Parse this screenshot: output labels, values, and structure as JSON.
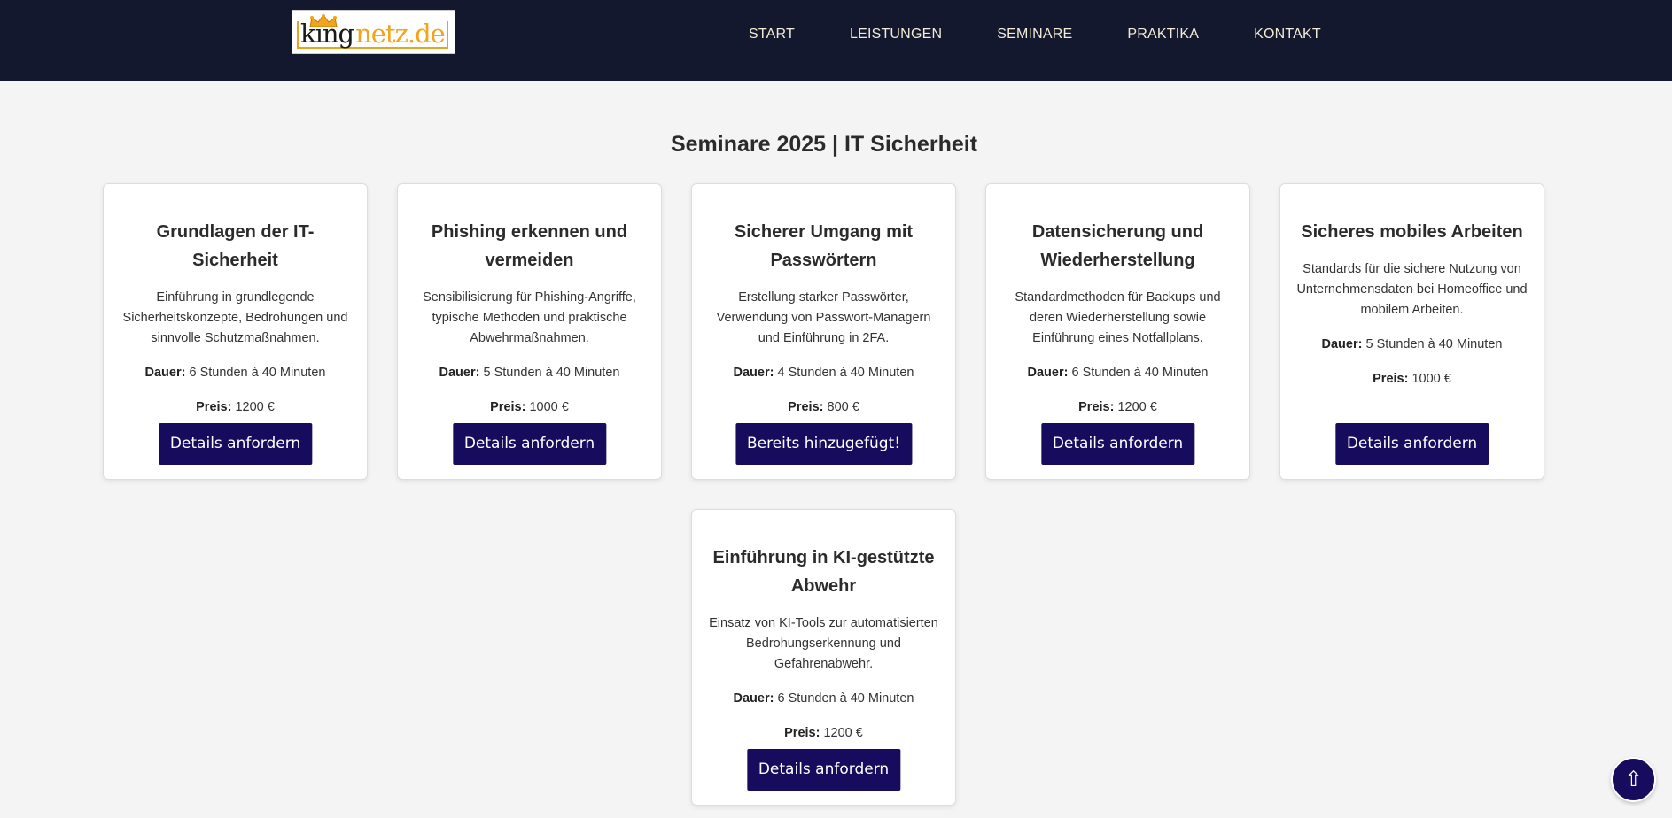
{
  "header": {
    "logo": {
      "part1": "king",
      "part2": "netz.de"
    },
    "nav": [
      "START",
      "LEISTUNGEN",
      "SEMINARE",
      "PRAKTIKA",
      "KONTAKT"
    ]
  },
  "page_title": "Seminare 2025 | IT Sicherheit",
  "labels": {
    "duration": "Dauer:",
    "price": "Preis:"
  },
  "seminars": [
    {
      "title": "Grundlagen der IT-Sicherheit",
      "desc": "Einführung in grundlegende Sicherheitskonzepte, Bedrohungen und sinnvolle Schutzmaßnahmen.",
      "duration": "6 Stunden à 40 Minuten",
      "price": "1200 €",
      "button": "Details anfordern"
    },
    {
      "title": "Phishing erkennen und vermeiden",
      "desc": "Sensibilisierung für Phishing-Angriffe, typische Methoden und praktische Abwehrmaßnahmen.",
      "duration": "5 Stunden à 40 Minuten",
      "price": "1000 €",
      "button": "Details anfordern"
    },
    {
      "title": "Sicherer Umgang mit Passwörtern",
      "desc": "Erstellung starker Passwörter, Verwendung von Passwort-Managern und Einführung in 2FA.",
      "duration": "4 Stunden à 40 Minuten",
      "price": "800 €",
      "button": "Bereits hinzugefügt!"
    },
    {
      "title": "Datensicherung und Wiederherstellung",
      "desc": "Standardmethoden für Backups und deren Wiederherstellung sowie Einführung eines Notfallplans.",
      "duration": "6 Stunden à 40 Minuten",
      "price": "1200 €",
      "button": "Details anfordern"
    },
    {
      "title": "Sicheres mobiles Arbeiten",
      "desc": "Standards für die sichere Nutzung von Unternehmensdaten bei Homeoffice und mobilem Arbeiten.",
      "duration": "5 Stunden à 40 Minuten",
      "price": "1000 €",
      "button": "Details anfordern"
    },
    {
      "title": "Einführung in KI-gestützte Abwehr",
      "desc": "Einsatz von KI-Tools zur automatisierten Bedrohungserkennung und Gefahrenabwehr.",
      "duration": "6 Stunden à 40 Minuten",
      "price": "1200 €",
      "button": "Details anfordern"
    }
  ],
  "back_to_top": "⇧",
  "colors": {
    "header_bg": "#13182f",
    "button_bg": "#170b5e",
    "page_bg": "#f4f4f4"
  }
}
